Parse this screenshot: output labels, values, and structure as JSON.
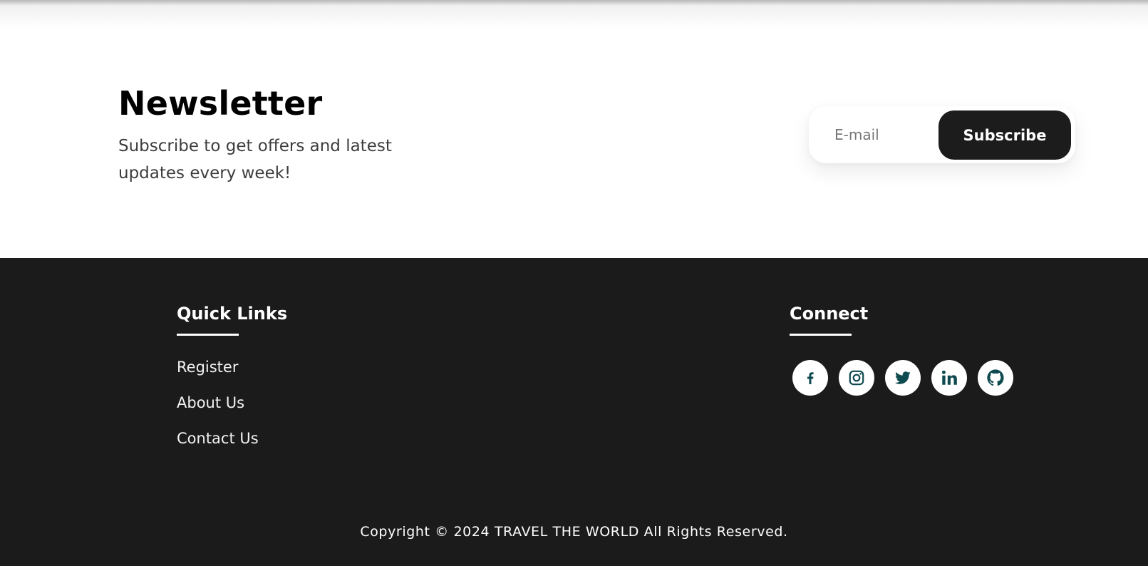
{
  "newsletter": {
    "title": "Newsletter",
    "subtitle": "Subscribe to get offers and latest updates every week!",
    "email_placeholder": "E-mail",
    "subscribe_label": "Subscribe"
  },
  "footer": {
    "quick_links": {
      "title": "Quick Links",
      "items": [
        {
          "label": "Register"
        },
        {
          "label": "About Us"
        },
        {
          "label": "Contact Us"
        }
      ]
    },
    "connect": {
      "title": "Connect",
      "icons": [
        "facebook-icon",
        "instagram-icon",
        "twitter-icon",
        "linkedin-icon",
        "github-icon"
      ],
      "icon_color": "#0e4a4f"
    },
    "copyright": "Copyright © 2024 TRAVEL THE WORLD All Rights Reserved."
  },
  "colors": {
    "footer_bg": "#1b1b1b",
    "button_bg": "#1c1c1c",
    "text_dark": "#000000",
    "text_muted": "#3d3d3d"
  }
}
